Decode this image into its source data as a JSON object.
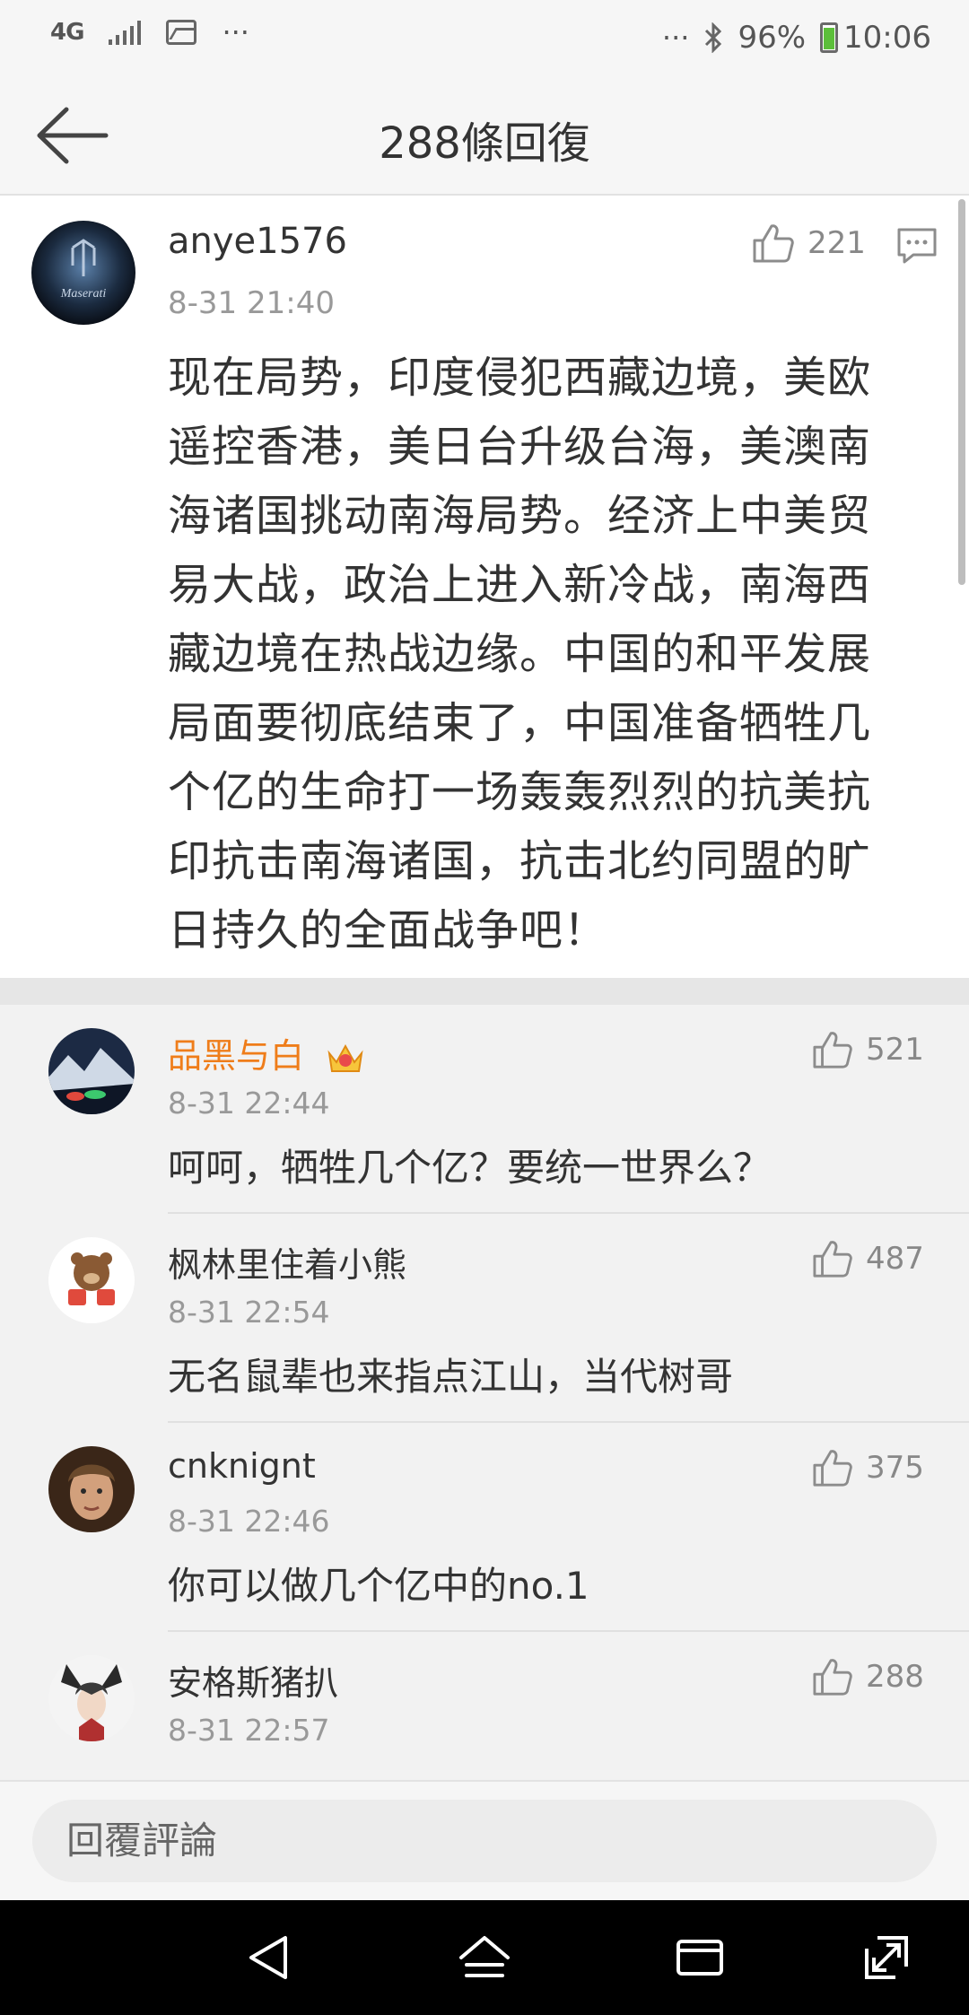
{
  "status_bar": {
    "network": "4G",
    "more": "···",
    "right_more": "···",
    "battery": "96%",
    "time": "10:06"
  },
  "header": {
    "title": "288條回復"
  },
  "post": {
    "username": "anye1576",
    "timestamp": "8-31 21:40",
    "likes": "221",
    "text": "现在局势，印度侵犯西藏边境，美欧遥控香港，美日台升级台海，美澳南海诸国挑动南海局势。经济上中美贸易大战，政治上进入新冷战，南海西藏边境在热战边缘。中国的和平发展局面要彻底结束了，中国准备牺牲几个亿的生命打一场轰轰烈烈的抗美抗印抗击南海诸国，抗击北约同盟的旷日持久的全面战争吧！",
    "avatar_text": "Maserati"
  },
  "replies": [
    {
      "username": "品黑与白",
      "timestamp": "8-31 22:44",
      "likes": "521",
      "text": "呵呵，牺牲几个亿？要统一世界么？"
    },
    {
      "username": "枫林里住着小熊",
      "timestamp": "8-31 22:54",
      "likes": "487",
      "text": "无名鼠辈也来指点江山，当代树哥"
    },
    {
      "username": "cnknignt",
      "timestamp": "8-31 22:46",
      "likes": "375",
      "text": "你可以做几个亿中的no.1"
    },
    {
      "username": "安格斯猪扒",
      "timestamp": "8-31 22:57",
      "likes": "288",
      "text": ""
    }
  ],
  "input": {
    "placeholder": "回覆評論"
  },
  "colors": {
    "vip_name": "#ef7d1a",
    "battery_fill": "#5cbf3a",
    "secondary_text": "#999999"
  }
}
